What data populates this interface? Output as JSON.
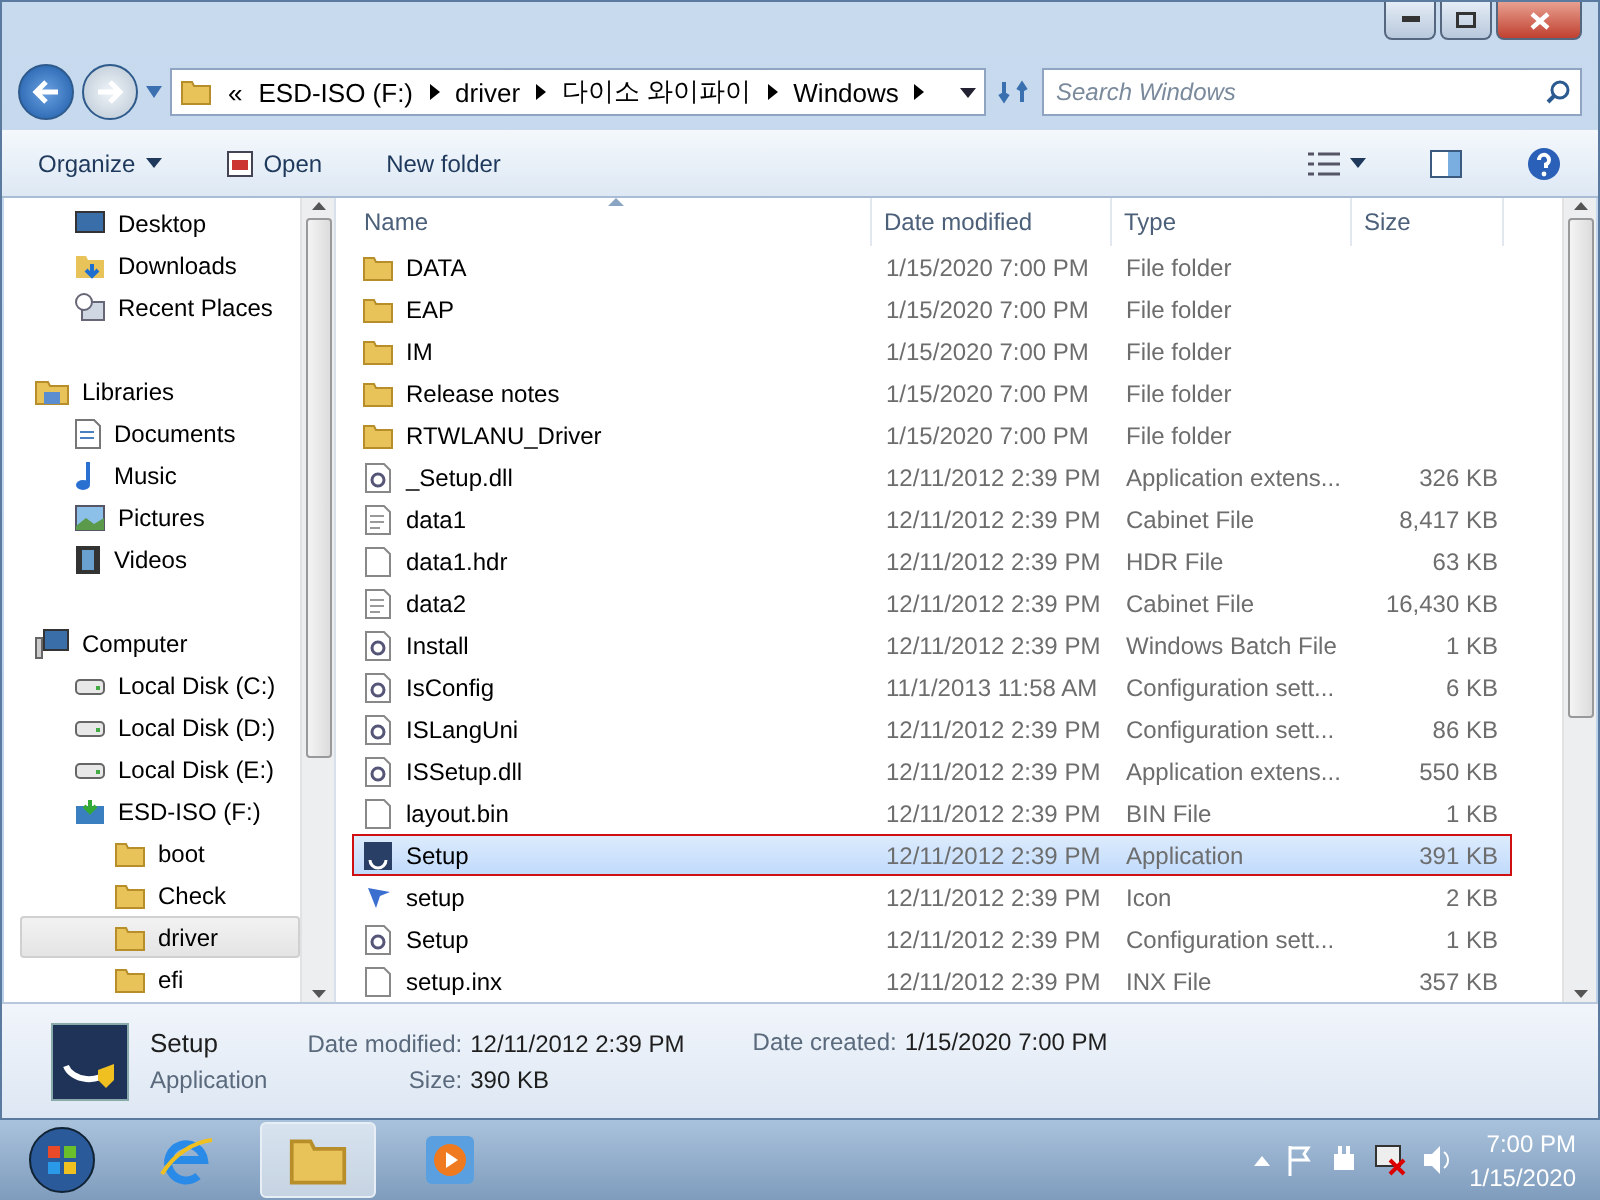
{
  "address_bar": {
    "overflow": "«",
    "crumbs": [
      "ESD-ISO (F:)",
      "driver",
      "다이소 와이파이",
      "Windows"
    ]
  },
  "search": {
    "placeholder": "Search Windows"
  },
  "toolbar": {
    "items": [
      {
        "label": "Organize",
        "kind": "menu"
      },
      {
        "label": "Open",
        "kind": "icon"
      },
      {
        "label": "New folder",
        "kind": "plain"
      }
    ]
  },
  "sidebar": {
    "groups": [
      {
        "children": [
          {
            "label": "Desktop",
            "kind": "desktop",
            "selected": false
          },
          {
            "label": "Downloads",
            "kind": "downloads",
            "selected": false
          },
          {
            "label": "Recent Places",
            "kind": "recent",
            "selected": false
          }
        ]
      },
      {
        "label": "Libraries",
        "kind": "libraries",
        "children": [
          {
            "label": "Documents",
            "kind": "documents",
            "selected": false
          },
          {
            "label": "Music",
            "kind": "music",
            "selected": false
          },
          {
            "label": "Pictures",
            "kind": "pictures",
            "selected": false
          },
          {
            "label": "Videos",
            "kind": "videos",
            "selected": false
          }
        ]
      },
      {
        "label": "Computer",
        "kind": "computer",
        "children": [
          {
            "label": "Local Disk (C:)",
            "kind": "disk",
            "selected": false
          },
          {
            "label": "Local Disk (D:)",
            "kind": "disk",
            "selected": false
          },
          {
            "label": "Local Disk (E:)",
            "kind": "disk",
            "selected": false
          },
          {
            "label": "ESD-ISO (F:)",
            "kind": "dvd",
            "selected": false,
            "children": [
              {
                "label": "boot",
                "kind": "folder",
                "selected": false
              },
              {
                "label": "Check",
                "kind": "folder",
                "selected": false
              },
              {
                "label": "driver",
                "kind": "folder",
                "selected": true
              },
              {
                "label": "efi",
                "kind": "folder",
                "selected": false
              }
            ]
          }
        ]
      }
    ]
  },
  "table": {
    "columns": [
      "Name",
      "Date modified",
      "Type",
      "Size"
    ],
    "rows": [
      {
        "name": "DATA",
        "date": "1/15/2020 7:00 PM",
        "type": "File folder",
        "size": "",
        "kind": "folder",
        "selected": false
      },
      {
        "name": "EAP",
        "date": "1/15/2020 7:00 PM",
        "type": "File folder",
        "size": "",
        "kind": "folder",
        "selected": false
      },
      {
        "name": "IM",
        "date": "1/15/2020 7:00 PM",
        "type": "File folder",
        "size": "",
        "kind": "folder",
        "selected": false
      },
      {
        "name": "Release notes",
        "date": "1/15/2020 7:00 PM",
        "type": "File folder",
        "size": "",
        "kind": "folder",
        "selected": false
      },
      {
        "name": "RTWLANU_Driver",
        "date": "1/15/2020 7:00 PM",
        "type": "File folder",
        "size": "",
        "kind": "folder",
        "selected": false
      },
      {
        "name": "_Setup.dll",
        "date": "12/11/2012 2:39 PM",
        "type": "Application extens...",
        "size": "326 KB",
        "kind": "gear",
        "selected": false
      },
      {
        "name": "data1",
        "date": "12/11/2012 2:39 PM",
        "type": "Cabinet File",
        "size": "8,417 KB",
        "kind": "doc",
        "selected": false
      },
      {
        "name": "data1.hdr",
        "date": "12/11/2012 2:39 PM",
        "type": "HDR File",
        "size": "63 KB",
        "kind": "blank",
        "selected": false
      },
      {
        "name": "data2",
        "date": "12/11/2012 2:39 PM",
        "type": "Cabinet File",
        "size": "16,430 KB",
        "kind": "doc",
        "selected": false
      },
      {
        "name": "Install",
        "date": "12/11/2012 2:39 PM",
        "type": "Windows Batch File",
        "size": "1 KB",
        "kind": "gear",
        "selected": false
      },
      {
        "name": "IsConfig",
        "date": "11/1/2013 11:58 AM",
        "type": "Configuration sett...",
        "size": "6 KB",
        "kind": "gear",
        "selected": false
      },
      {
        "name": "ISLangUni",
        "date": "12/11/2012 2:39 PM",
        "type": "Configuration sett...",
        "size": "86 KB",
        "kind": "gear",
        "selected": false
      },
      {
        "name": "ISSetup.dll",
        "date": "12/11/2012 2:39 PM",
        "type": "Application extens...",
        "size": "550 KB",
        "kind": "gear",
        "selected": false
      },
      {
        "name": "layout.bin",
        "date": "12/11/2012 2:39 PM",
        "type": "BIN File",
        "size": "1 KB",
        "kind": "blank",
        "selected": false
      },
      {
        "name": "Setup",
        "date": "12/11/2012 2:39 PM",
        "type": "Application",
        "size": "391 KB",
        "kind": "app",
        "selected": true
      },
      {
        "name": "setup",
        "date": "12/11/2012 2:39 PM",
        "type": "Icon",
        "size": "2 KB",
        "kind": "icon",
        "selected": false
      },
      {
        "name": "Setup",
        "date": "12/11/2012 2:39 PM",
        "type": "Configuration sett...",
        "size": "1 KB",
        "kind": "gear",
        "selected": false
      },
      {
        "name": "setup.inx",
        "date": "12/11/2012 2:39 PM",
        "type": "INX File",
        "size": "357 KB",
        "kind": "blank",
        "selected": false
      }
    ]
  },
  "details": {
    "name": "Setup",
    "type": "Application",
    "fields": [
      {
        "label": "Date modified:",
        "value": "12/11/2012 2:39 PM"
      },
      {
        "label": "Date created:",
        "value": "1/15/2020 7:00 PM"
      },
      {
        "label": "Size:",
        "value": "390 KB"
      }
    ]
  },
  "taskbar": {
    "apps": [
      {
        "kind": "ie",
        "selected": false
      },
      {
        "kind": "explorer",
        "selected": true
      },
      {
        "kind": "media",
        "selected": false
      }
    ],
    "time": "7:00 PM",
    "date": "1/15/2020"
  }
}
